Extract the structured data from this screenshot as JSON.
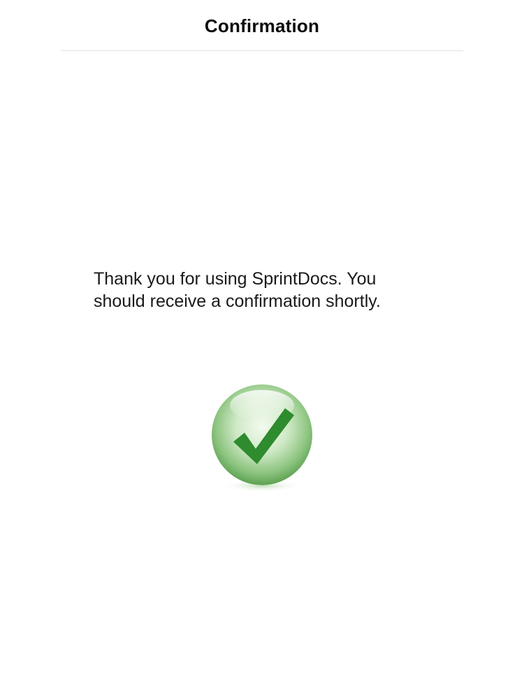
{
  "header": {
    "title": "Confirmation"
  },
  "main": {
    "message": "Thank you for using SprintDocs. You should receive a confirmation shortly.",
    "status_icon": "checkmark-circle-icon"
  },
  "colors": {
    "success_green": "#2e8b2e",
    "sphere_light": "#e6f5e0",
    "sphere_dark": "#6cae5f",
    "divider": "#e2e2e2"
  }
}
